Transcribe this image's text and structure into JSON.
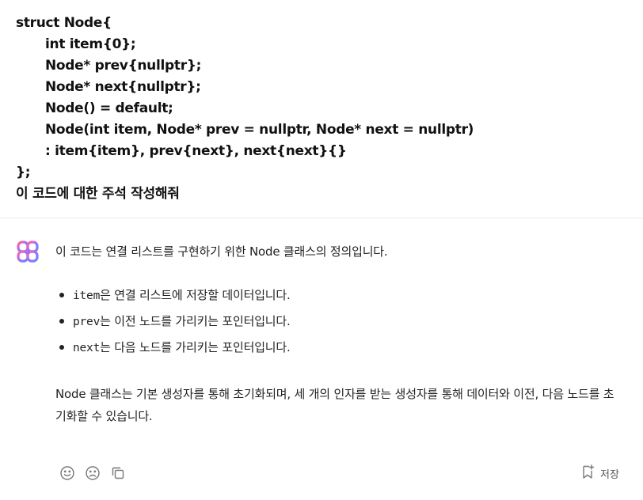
{
  "user_message": {
    "lines": [
      "struct Node{",
      "int item{0};",
      "Node* prev{nullptr};",
      "Node* next{nullptr};",
      "Node() = default;",
      "Node(int item, Node* prev = nullptr, Node* next = nullptr)",
      ": item{item}, prev{next}, next{next}{}",
      "};",
      "이 코드에 대한 주석 작성해줘"
    ]
  },
  "assistant": {
    "intro": "이 코드는 연결 리스트를 구현하기 위한 Node 클래스의 정의입니다.",
    "bullets": [
      {
        "code": "item",
        "text": "은 연결 리스트에 저장할 데이터입니다."
      },
      {
        "code": "prev",
        "text": "는 이전 노드를 가리키는 포인터입니다."
      },
      {
        "code": "next",
        "text": "는 다음 노드를 가리키는 포인터입니다."
      }
    ],
    "summary": "Node 클래스는 기본 생성자를 통해 초기화되며, 세 개의 인자를 받는 생성자를 통해 데이터와 이전, 다음 노드를 초기화할 수 있습니다."
  },
  "actions": {
    "save_label": "저장",
    "icons": [
      "smile-icon",
      "frown-icon",
      "copy-icon",
      "bookmark-add-icon"
    ]
  },
  "colors": {
    "accent_gradient": [
      "#ff6a9a",
      "#a46bff",
      "#5f8cff"
    ],
    "divider": "#e8e8e8"
  }
}
